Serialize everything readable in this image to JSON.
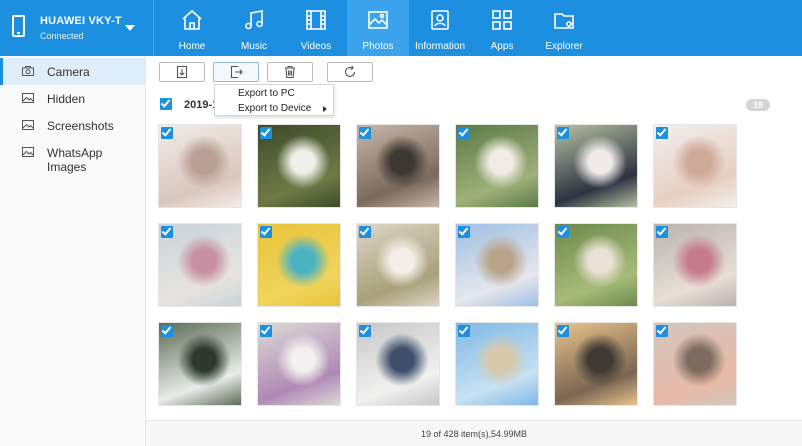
{
  "device": {
    "name": "HUAWEI VKY-T",
    "status": "Connected"
  },
  "nav": [
    {
      "id": "home",
      "label": "Home",
      "icon": "home-icon"
    },
    {
      "id": "music",
      "label": "Music",
      "icon": "music-note-icon"
    },
    {
      "id": "videos",
      "label": "Videos",
      "icon": "film-icon"
    },
    {
      "id": "photos",
      "label": "Photos",
      "icon": "image-icon",
      "active": true
    },
    {
      "id": "information",
      "label": "Information",
      "icon": "contact-card-icon"
    },
    {
      "id": "apps",
      "label": "Apps",
      "icon": "apps-grid-icon"
    },
    {
      "id": "explorer",
      "label": "Explorer",
      "icon": "folder-icon"
    }
  ],
  "sidebar": {
    "items": [
      {
        "label": "Camera",
        "icon": "camera-icon",
        "active": true
      },
      {
        "label": "Hidden",
        "icon": "image-icon"
      },
      {
        "label": "Screenshots",
        "icon": "image-icon"
      },
      {
        "label": "WhatsApp Images",
        "icon": "image-icon"
      }
    ]
  },
  "toolbar": {
    "buttons": [
      {
        "id": "import",
        "icon": "import-icon"
      },
      {
        "id": "export",
        "icon": "export-icon"
      },
      {
        "id": "delete",
        "icon": "trash-icon"
      },
      {
        "id": "refresh",
        "icon": "refresh-icon"
      }
    ]
  },
  "export_menu": {
    "items": [
      {
        "label": "Export to PC"
      },
      {
        "label": "Export to Device",
        "has_submenu": true
      }
    ]
  },
  "group": {
    "title": "2019-1",
    "count": "19",
    "checked": true
  },
  "photos": [
    {
      "colors": [
        "#f3ece8",
        "#d9c7bd",
        "#b89f93"
      ]
    },
    {
      "colors": [
        "#3d4a2a",
        "#6e7a45",
        "#efeee8"
      ]
    },
    {
      "colors": [
        "#c7b7aa",
        "#7a6a5d",
        "#3e3833"
      ]
    },
    {
      "colors": [
        "#5b7a45",
        "#9fb07a",
        "#f1ede6"
      ]
    },
    {
      "colors": [
        "#b6c1a4",
        "#2d3340",
        "#f0eaea"
      ]
    },
    {
      "colors": [
        "#f1efee",
        "#e7cfc2",
        "#cfa898"
      ]
    },
    {
      "colors": [
        "#c8d4da",
        "#e7e4e0",
        "#c98fa2"
      ]
    },
    {
      "colors": [
        "#e9c43a",
        "#f0d45c",
        "#4ab3c2"
      ]
    },
    {
      "colors": [
        "#ded4c6",
        "#a8a17a",
        "#f3efe8"
      ]
    },
    {
      "colors": [
        "#9fbfe3",
        "#e6e7ec",
        "#b9a48a"
      ]
    },
    {
      "colors": [
        "#6c8a4c",
        "#a7bb78",
        "#e9e2d6"
      ]
    },
    {
      "colors": [
        "#b9b3ad",
        "#e8ded6",
        "#c67a8a"
      ]
    },
    {
      "colors": [
        "#5b6b55",
        "#e9ece9",
        "#2e3a2d"
      ]
    },
    {
      "colors": [
        "#dcdad6",
        "#b089b6",
        "#f3f1ef"
      ]
    },
    {
      "colors": [
        "#c6c7c9",
        "#f2f1f0",
        "#3e4e6b"
      ]
    },
    {
      "colors": [
        "#7fb8e5",
        "#c8e1f3",
        "#d8c9ab"
      ]
    },
    {
      "colors": [
        "#e8c48d",
        "#7a6552",
        "#3f3a33"
      ]
    },
    {
      "colors": [
        "#d3c6bf",
        "#e8b9a6",
        "#7c6b5f"
      ]
    }
  ],
  "status": {
    "text": "19 of 428 item(s),54.99MB"
  }
}
